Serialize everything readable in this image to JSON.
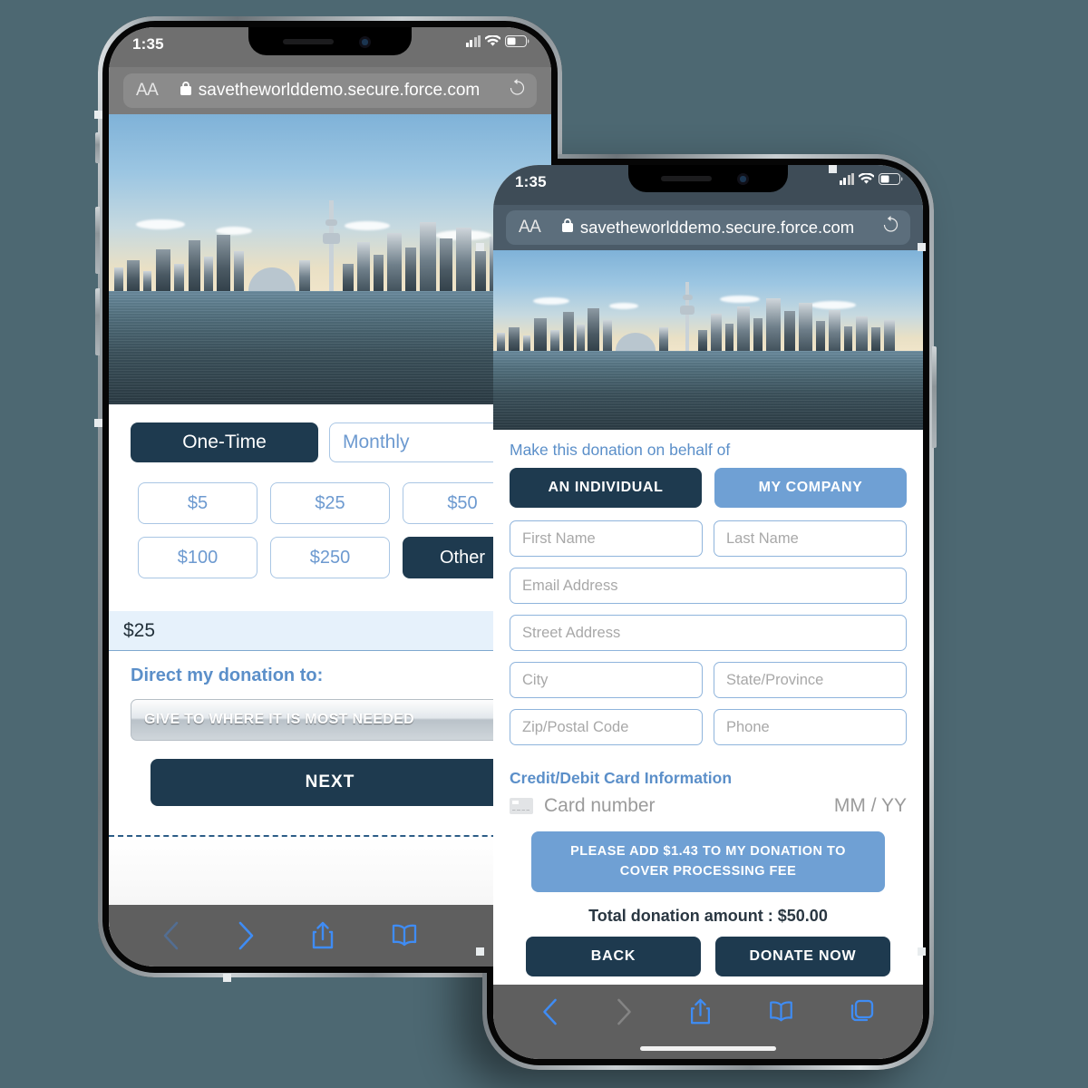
{
  "background_color": "#4d6872",
  "theme": {
    "navy": "#1e3a4f",
    "light_blue": "#6fa0d4",
    "link_blue": "#5b8fc9",
    "field_border": "#8fb4dc",
    "amount_bar_bg": "#e6f1fb"
  },
  "back_phone": {
    "status_bar": {
      "time": "1:35",
      "signal_icon": "cellular-bars-icon",
      "wifi_icon": "wifi-icon",
      "battery_icon": "battery-icon"
    },
    "browser": {
      "aa_label": "AA",
      "lock_icon": "lock-icon",
      "url": "savetheworlddemo.secure.force.com",
      "reload_icon": "reload-icon"
    },
    "hero": {
      "alt": "toronto-skyline-waterfront-photo"
    },
    "frequency_tabs": [
      {
        "label": "One-Time",
        "selected": true
      },
      {
        "label": "Monthly",
        "selected": false
      }
    ],
    "amount_buttons": [
      {
        "label": "$5",
        "selected": false
      },
      {
        "label": "$25",
        "selected": false
      },
      {
        "label": "$50",
        "selected": false
      },
      {
        "label": "$100",
        "selected": false
      },
      {
        "label": "$250",
        "selected": false
      },
      {
        "label": "Other",
        "selected": true
      }
    ],
    "amount_input_value": "$25",
    "direct_label": "Direct my donation to:",
    "designation_selected": "GIVE TO WHERE IT IS MOST NEEDED",
    "next_label": "NEXT",
    "toolbar": {
      "back_icon": "chevron-left-icon",
      "forward_icon": "chevron-right-icon",
      "share_icon": "share-icon",
      "bookmarks_icon": "book-icon"
    }
  },
  "front_phone": {
    "status_bar": {
      "time": "1:35",
      "signal_icon": "cellular-bars-icon",
      "wifi_icon": "wifi-icon",
      "battery_icon": "battery-icon"
    },
    "browser": {
      "aa_label": "AA",
      "lock_icon": "lock-icon",
      "url": "savetheworlddemo.secure.force.com",
      "reload_icon": "reload-icon"
    },
    "hero": {
      "alt": "toronto-skyline-waterfront-photo"
    },
    "behalf_label": "Make this donation on behalf of",
    "behalf_tabs": [
      {
        "label": "AN INDIVIDUAL",
        "selected": true
      },
      {
        "label": "MY COMPANY",
        "selected": false
      }
    ],
    "fields": [
      {
        "name": "first-name",
        "placeholder": "First Name",
        "value": "",
        "width": "half"
      },
      {
        "name": "last-name",
        "placeholder": "Last Name",
        "value": "",
        "width": "half"
      },
      {
        "name": "email-address",
        "placeholder": "Email Address",
        "value": "",
        "width": "full"
      },
      {
        "name": "street-address",
        "placeholder": "Street Address",
        "value": "",
        "width": "full"
      },
      {
        "name": "city",
        "placeholder": "City",
        "value": "",
        "width": "half"
      },
      {
        "name": "state-province",
        "placeholder": "State/Province",
        "value": "",
        "width": "half"
      },
      {
        "name": "zip-postal-code",
        "placeholder": "Zip/Postal Code",
        "value": "",
        "width": "half"
      },
      {
        "name": "phone",
        "placeholder": "Phone",
        "value": "",
        "width": "half"
      }
    ],
    "card_section": {
      "heading": "Credit/Debit Card Information",
      "card_icon": "credit-card-icon",
      "card_number_placeholder": "Card number",
      "expiry_placeholder": "MM / YY"
    },
    "processing_fee_label": "PLEASE ADD $1.43 TO MY DONATION TO COVER PROCESSING FEE",
    "total_label": "Total donation amount : $50.00",
    "actions": [
      {
        "label": "BACK",
        "name": "back-button"
      },
      {
        "label": "DONATE NOW",
        "name": "donate-now-button"
      }
    ],
    "toolbar": {
      "back_icon": "chevron-left-icon",
      "forward_icon": "chevron-right-icon",
      "share_icon": "share-icon",
      "bookmarks_icon": "book-icon",
      "tabs_icon": "tabs-icon"
    }
  }
}
